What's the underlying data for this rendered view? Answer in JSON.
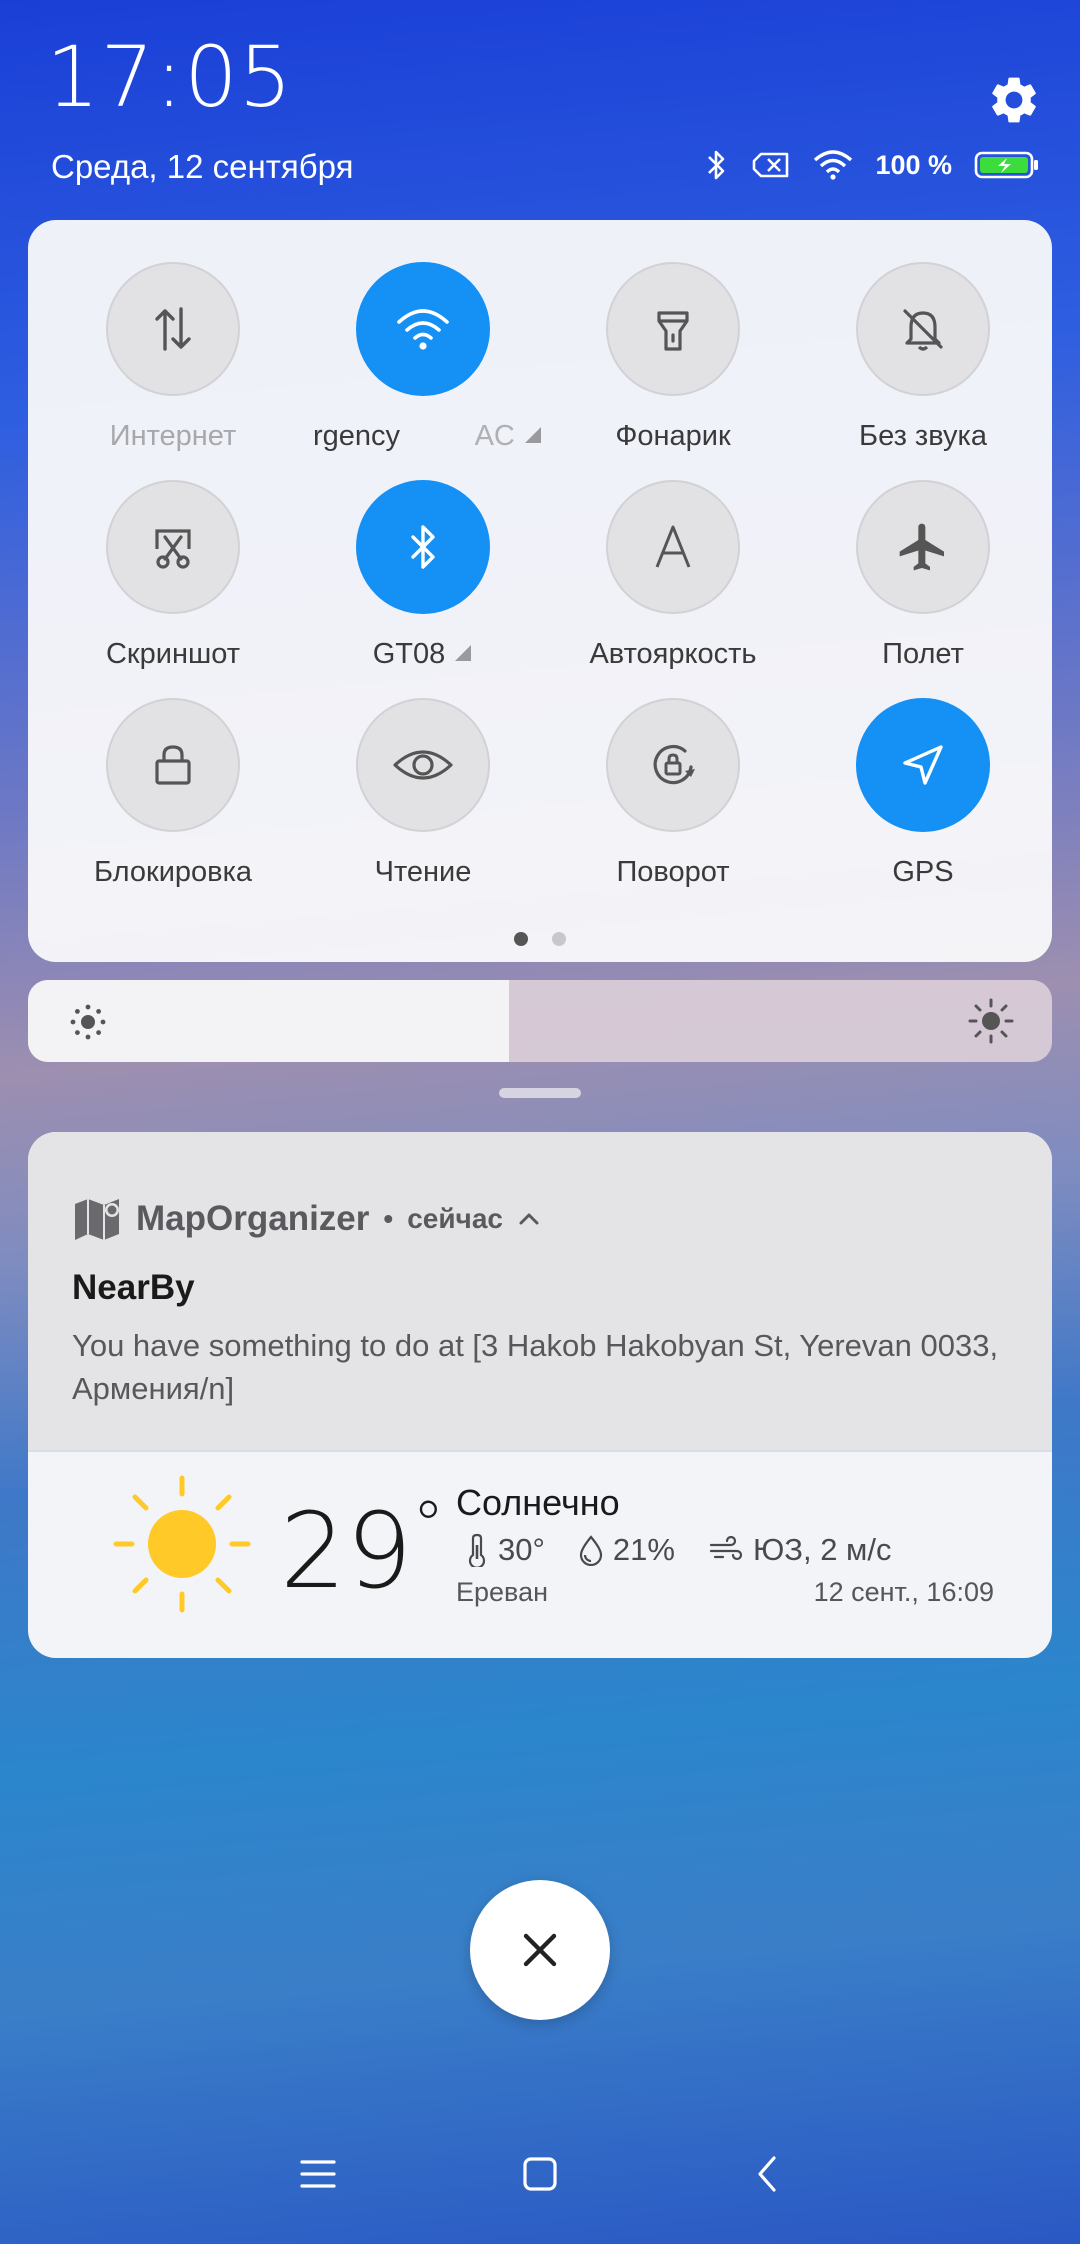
{
  "header": {
    "time": "17:05",
    "date": "Среда, 12 сентября",
    "battery_text": "100 %",
    "settings_icon": "gear-icon"
  },
  "status_icons": [
    "bluetooth-icon",
    "no-sim-icon",
    "wifi-icon",
    "battery-charging-icon"
  ],
  "colors": {
    "accent": "#1590F4",
    "tile_off": "#E2E2E4",
    "battery_green": "#3DDC3D",
    "sun": "#FFCA28"
  },
  "quick_settings": {
    "tiles": [
      {
        "label": "Интернет",
        "icon": "mobile-data-icon",
        "active": false
      },
      {
        "label": "rgency",
        "label_suffix": "AC",
        "icon": "wifi-icon",
        "active": true
      },
      {
        "label": "Фонарик",
        "icon": "flashlight-icon",
        "active": false
      },
      {
        "label": "Без звука",
        "icon": "bell-off-icon",
        "active": false
      },
      {
        "label": "Скриншот",
        "icon": "screenshot-icon",
        "active": false
      },
      {
        "label": "GT08",
        "icon": "bluetooth-icon",
        "active": true
      },
      {
        "label": "Автояркость",
        "icon": "auto-brightness-icon",
        "active": false
      },
      {
        "label": "Полет",
        "icon": "airplane-icon",
        "active": false
      },
      {
        "label": "Блокировка",
        "icon": "lock-icon",
        "active": false
      },
      {
        "label": "Чтение",
        "icon": "eye-icon",
        "active": false
      },
      {
        "label": "Поворот",
        "icon": "rotation-lock-icon",
        "active": false
      },
      {
        "label": "GPS",
        "icon": "location-arrow-icon",
        "active": true
      }
    ],
    "page_count": 2,
    "current_page": 1
  },
  "brightness": {
    "level_fraction": 0.47
  },
  "notification": {
    "app_name": "MapOrganizer",
    "separator": "•",
    "time": "сейчас",
    "title": "NearBy",
    "body": "You have something to do at [3 Hakob Hakobyan St, Yerevan 0033, Армения/n]"
  },
  "weather": {
    "temperature": "29",
    "degree": "°",
    "condition": "Солнечно",
    "feels_like": "30°",
    "humidity": "21%",
    "wind": "ЮЗ, 2 м/с",
    "city": "Ереван",
    "updated": "12 сент., 16:09"
  }
}
